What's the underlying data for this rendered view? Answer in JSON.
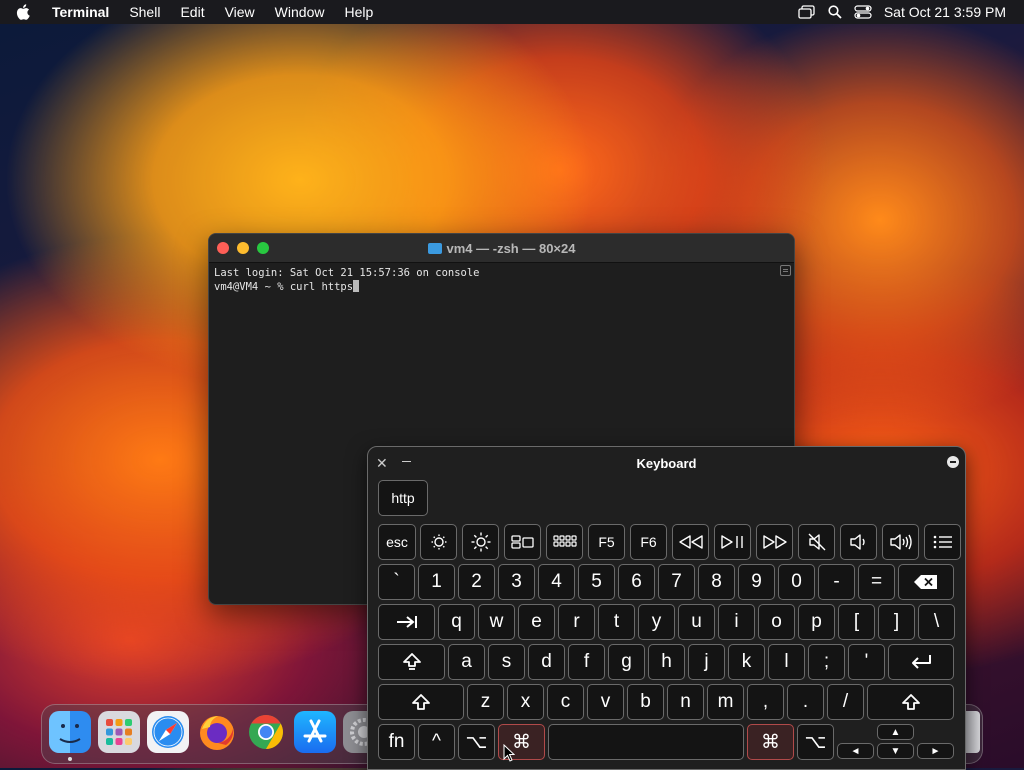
{
  "menubar": {
    "app": "Terminal",
    "items": [
      "Shell",
      "Edit",
      "View",
      "Window",
      "Help"
    ],
    "clock": "Sat Oct 21  3:59 PM"
  },
  "terminal": {
    "title": "vm4 — -zsh — 80×24",
    "line1": "Last login: Sat Oct 21 15:57:36 on console",
    "line2": "vm4@VM4 ~ % curl https"
  },
  "keyboard": {
    "title": "Keyboard",
    "suggestion": "http",
    "fn_row": [
      "esc",
      "brightness-down-icon",
      "brightness-up-icon",
      "mission-control-icon",
      "launchpad-icon",
      "F5",
      "F6",
      "rewind-icon",
      "play-pause-icon",
      "fast-forward-icon",
      "mute-icon",
      "volume-down-icon",
      "volume-up-icon",
      "list-icon"
    ],
    "f5": "F5",
    "f6": "F6",
    "esc": "esc",
    "row1": [
      "`",
      "1",
      "2",
      "3",
      "4",
      "5",
      "6",
      "7",
      "8",
      "9",
      "0",
      "-",
      "="
    ],
    "row2": [
      "q",
      "w",
      "e",
      "r",
      "t",
      "y",
      "u",
      "i",
      "o",
      "p",
      "[",
      "]",
      "\\"
    ],
    "row3": [
      "a",
      "s",
      "d",
      "f",
      "g",
      "h",
      "j",
      "k",
      "l",
      ";",
      "'"
    ],
    "row4": [
      "z",
      "x",
      "c",
      "v",
      "b",
      "n",
      "m",
      ",",
      ".",
      "/"
    ],
    "fn": "fn",
    "ctrl": "^",
    "option": "⌥",
    "command": "⌘",
    "arrows": [
      "▲",
      "◄",
      "▼",
      "►"
    ]
  },
  "dock": {
    "apps": [
      "finder",
      "launchpad",
      "safari",
      "firefox",
      "chrome",
      "app-store",
      "system-settings",
      "trash"
    ]
  },
  "colors": {
    "terminal_bg": "#1e1e1e",
    "pressed_key": "#b14a4a"
  }
}
